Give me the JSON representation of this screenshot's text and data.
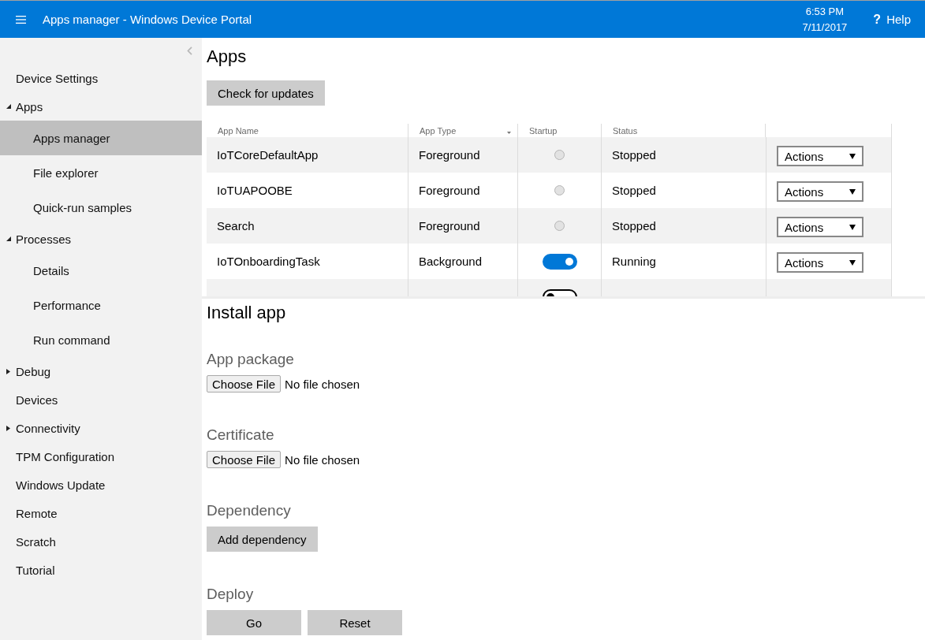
{
  "header": {
    "title": "Apps manager - Windows Device Portal",
    "time": "6:53 PM",
    "date": "7/11/2017",
    "help": {
      "icon": "?",
      "label": "Help"
    }
  },
  "sidebar": {
    "items": [
      {
        "label": "Device Settings",
        "selected": false
      },
      {
        "label": "Apps",
        "selected": false,
        "expanded": true,
        "children": [
          {
            "label": "Apps manager",
            "selected": true
          },
          {
            "label": "File explorer",
            "selected": false
          },
          {
            "label": "Quick-run samples",
            "selected": false
          }
        ]
      },
      {
        "label": "Processes",
        "selected": false,
        "expanded": true,
        "children": [
          {
            "label": "Details",
            "selected": false
          },
          {
            "label": "Performance",
            "selected": false
          },
          {
            "label": "Run command",
            "selected": false
          }
        ]
      },
      {
        "label": "Debug",
        "selected": false,
        "expanded": false
      },
      {
        "label": "Devices",
        "selected": false
      },
      {
        "label": "Connectivity",
        "selected": false,
        "expanded": false
      },
      {
        "label": "TPM Configuration",
        "selected": false
      },
      {
        "label": "Windows Update",
        "selected": false
      },
      {
        "label": "Remote",
        "selected": false
      },
      {
        "label": "Scratch",
        "selected": false
      },
      {
        "label": "Tutorial",
        "selected": false
      }
    ]
  },
  "apps": {
    "title": "Apps",
    "check_button": "Check for updates",
    "table": {
      "columns": [
        {
          "label": "App Name",
          "sorted": false
        },
        {
          "label": "App Type",
          "sorted": true
        },
        {
          "label": "Startup",
          "sorted": false
        },
        {
          "label": "Status",
          "sorted": false
        }
      ],
      "rows": [
        {
          "name": "IoTCoreDefaultApp",
          "type": "Foreground",
          "startup": {
            "kind": "radio",
            "on": false
          },
          "status": "Stopped",
          "action": "Actions"
        },
        {
          "name": "IoTUAPOOBE",
          "type": "Foreground",
          "startup": {
            "kind": "radio",
            "on": false
          },
          "status": "Stopped",
          "action": "Actions"
        },
        {
          "name": "Search",
          "type": "Foreground",
          "startup": {
            "kind": "radio",
            "on": false
          },
          "status": "Stopped",
          "action": "Actions"
        },
        {
          "name": "IoTOnboardingTask",
          "type": "Background",
          "startup": {
            "kind": "toggle",
            "on": true
          },
          "status": "Running",
          "action": "Actions"
        },
        {
          "startup": {
            "kind": "toggle",
            "on": false
          }
        }
      ]
    }
  },
  "install": {
    "title": "Install app",
    "sections": [
      {
        "kind": "file",
        "label": "App package",
        "button": "Choose File",
        "value": "No file chosen"
      },
      {
        "kind": "file",
        "label": "Certificate",
        "button": "Choose File",
        "value": "No file chosen"
      },
      {
        "kind": "buttons",
        "label": "Dependency",
        "buttons": [
          "Add dependency"
        ]
      },
      {
        "kind": "buttons",
        "label": "Deploy",
        "buttons": [
          "Go",
          "Reset"
        ]
      }
    ]
  }
}
